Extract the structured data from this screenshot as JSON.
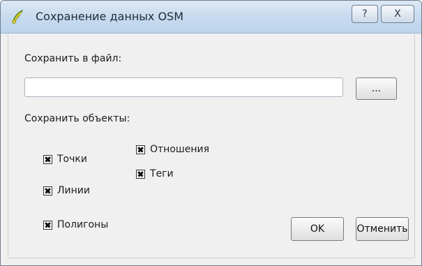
{
  "window": {
    "title": "Сохранение данных OSM",
    "help_label": "?",
    "close_label": "X"
  },
  "save_to_file": {
    "label": "Сохранить в файл:",
    "value": "",
    "placeholder": "",
    "browse_label": "..."
  },
  "save_objects": {
    "label": "Сохранить объекты:",
    "options": [
      {
        "label": "Точки",
        "checked": true
      },
      {
        "label": "Линии",
        "checked": true
      },
      {
        "label": "Полигоны",
        "checked": true
      },
      {
        "label": "Отношения",
        "checked": true
      },
      {
        "label": "Теги",
        "checked": true
      }
    ]
  },
  "buttons": {
    "ok_label": "OK",
    "cancel_label": "Отменить"
  },
  "colors": {
    "titlebar": "#c9dcf0",
    "background": "#f0f0f0",
    "qgis_icon_green": "#8cbf3f",
    "qgis_icon_yellow": "#e7c62a"
  }
}
